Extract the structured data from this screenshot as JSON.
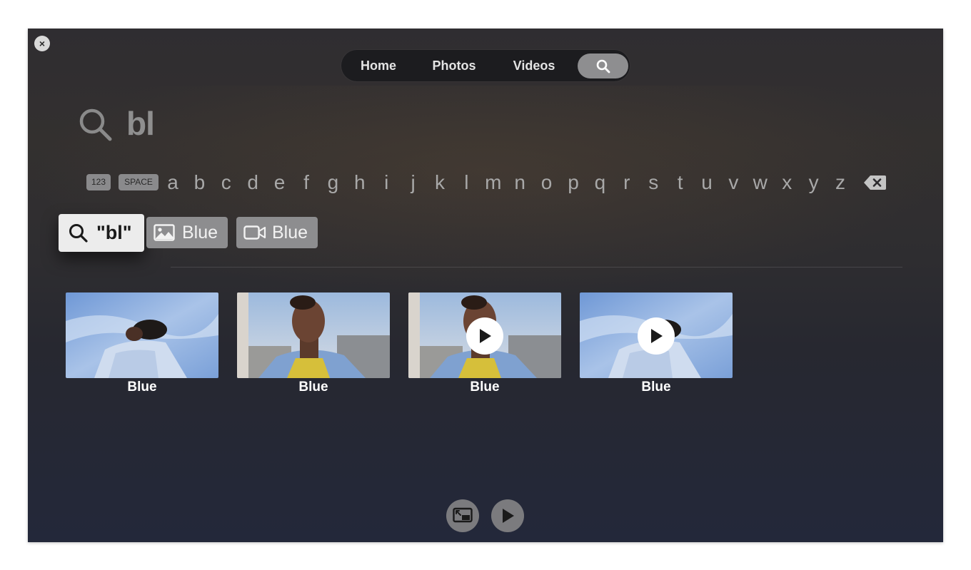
{
  "window": {
    "close_label": "×"
  },
  "nav": {
    "tabs": [
      {
        "label": "Home"
      },
      {
        "label": "Photos"
      },
      {
        "label": "Videos"
      }
    ],
    "search_icon": "search-icon"
  },
  "search": {
    "query": "bl",
    "icon": "search-icon"
  },
  "keyboard": {
    "numbers_label": "123",
    "space_label": "SPACE",
    "letters": [
      "a",
      "b",
      "c",
      "d",
      "e",
      "f",
      "g",
      "h",
      "i",
      "j",
      "k",
      "l",
      "m",
      "n",
      "o",
      "p",
      "q",
      "r",
      "s",
      "t",
      "u",
      "v",
      "w",
      "x",
      "y",
      "z"
    ],
    "backspace_icon": "backspace-icon"
  },
  "suggestions": {
    "query_label": "\"bl\"",
    "photo_label": "Blue",
    "video_label": "Blue"
  },
  "results": [
    {
      "label": "Blue",
      "kind": "photo"
    },
    {
      "label": "Blue",
      "kind": "photo"
    },
    {
      "label": "Blue",
      "kind": "video"
    },
    {
      "label": "Blue",
      "kind": "video"
    }
  ],
  "controls": {
    "pip_icon": "picture-in-picture-icon",
    "play_icon": "play-icon"
  },
  "colors": {
    "background_top": "#2f2d31",
    "background_bottom": "#23283a",
    "nav_bg": "#1c1c1f",
    "selected_tab": "#8e8e90",
    "suggestion_active": "#ececec",
    "suggestion_inactive": "#8d8d8f"
  }
}
